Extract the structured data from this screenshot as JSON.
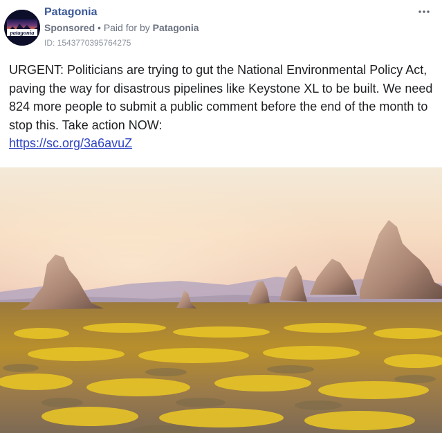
{
  "post": {
    "page_name": "Patagonia",
    "avatar_logo_text": "patagonia",
    "sponsored_label": "Sponsored",
    "separator": "•",
    "paid_for_prefix": "Paid for by",
    "paid_for_by": "Patagonia",
    "ad_id": "ID: 1543770395764275",
    "more_icon": "ellipsis-icon",
    "body_text": "URGENT: Politicians are trying to gut the National Environmental Policy Act, paving the way for disastrous pipelines like Keystone XL to be built. We need 824 more people to submit a public comment before the end of the month to stop this. Take action NOW:",
    "link_text": "https://sc.org/3a6avuZ",
    "image_subject": "desert landscape with rock spires and yellow wildflowers"
  },
  "colors": {
    "page_name": "#3b5998",
    "meta": "#6a7180",
    "link": "#2f43c2",
    "text": "#1c1e21"
  }
}
